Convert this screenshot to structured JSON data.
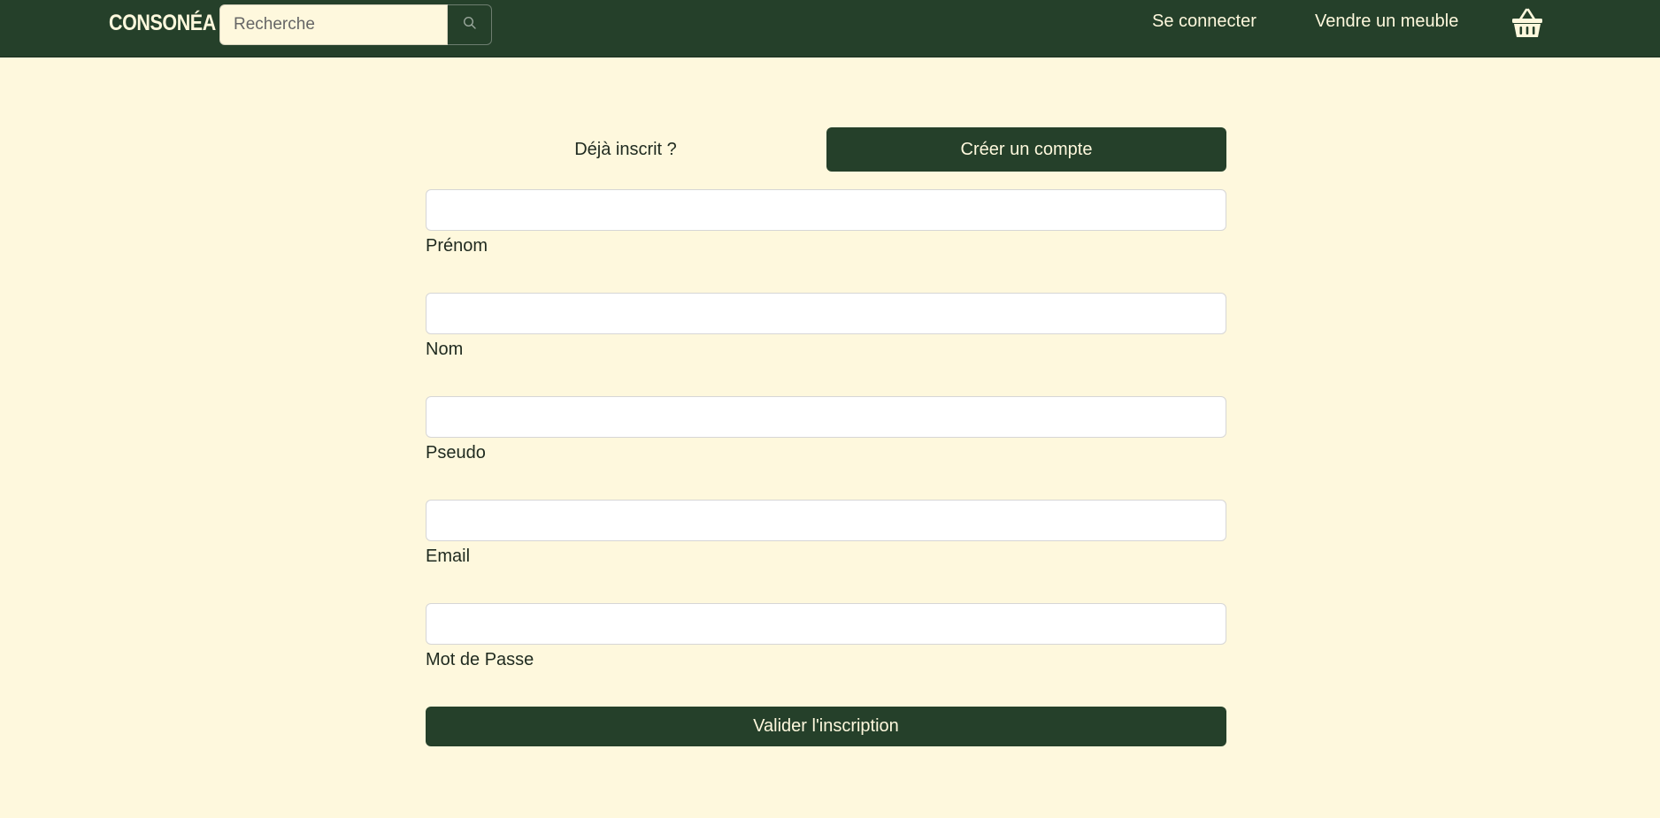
{
  "navbar": {
    "brand": "CONSONÉA",
    "search_placeholder": "Recherche",
    "search_icon": "search-icon",
    "login_label": "Se connecter",
    "sell_label": "Vendre un meuble",
    "basket_icon": "basket-icon"
  },
  "tabs": {
    "login": "Déjà inscrit ?",
    "signup": "Créer un compte",
    "active": "signup"
  },
  "form": {
    "fields": [
      {
        "label": "Prénom",
        "value": ""
      },
      {
        "label": "Nom",
        "value": ""
      },
      {
        "label": "Pseudo",
        "value": ""
      },
      {
        "label": "Email",
        "value": ""
      },
      {
        "label": "Mot de Passe",
        "value": ""
      }
    ],
    "submit_label": "Valider l'inscription"
  },
  "colors": {
    "primary": "#25402a",
    "background": "#fef8dd",
    "text_on_primary": "#fef8dd"
  }
}
